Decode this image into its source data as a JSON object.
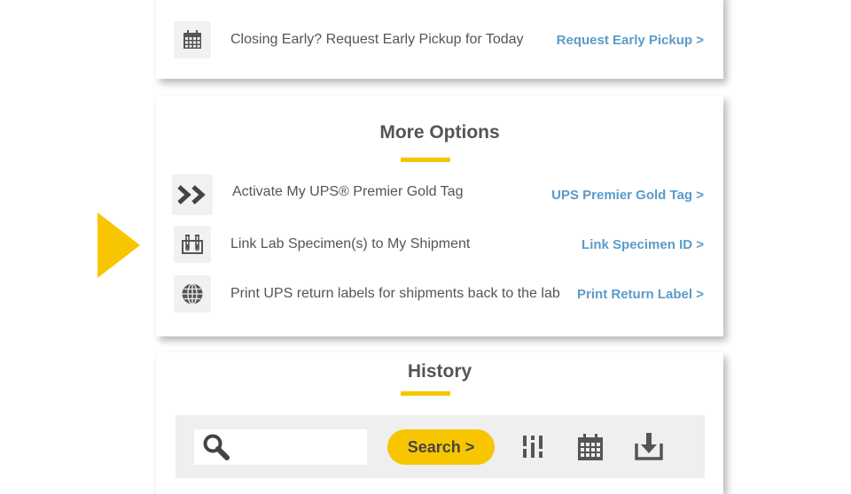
{
  "pickup": {
    "text": "Closing Early? Request Early Pickup for Today",
    "link": "Request Early Pickup >"
  },
  "more_options": {
    "title": "More Options",
    "items": [
      {
        "icon": "double-chevron-right-icon",
        "text": "Activate My UPS® Premier Gold Tag",
        "link": "UPS Premier Gold Tag >"
      },
      {
        "icon": "test-tubes-icon",
        "text": "Link Lab Specimen(s) to My Shipment",
        "link": "Link Specimen ID >"
      },
      {
        "icon": "globe-icon",
        "text": "Print UPS return labels for shipments back to the lab",
        "link": "Print Return Label >"
      }
    ]
  },
  "history": {
    "title": "History",
    "search_placeholder": "",
    "search_button": "Search >",
    "tools": [
      "filter-icon",
      "calendar-icon",
      "download-icon"
    ]
  },
  "colors": {
    "accent": "#f7c600",
    "link": "#5b9bc9",
    "text": "#555555",
    "icon_bg": "#f1f1f1",
    "panel_bg": "#efefef"
  }
}
